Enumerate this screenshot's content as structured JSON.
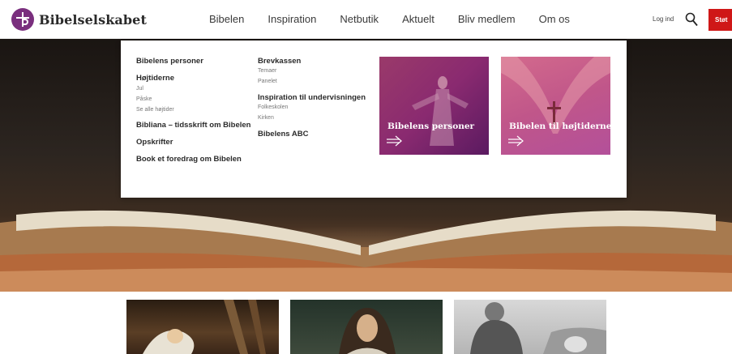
{
  "header": {
    "logo_text": "Bibelselskabet",
    "nav": [
      "Bibelen",
      "Inspiration",
      "Netbutik",
      "Aktuelt",
      "Bliv medlem",
      "Om os"
    ],
    "login": "Log ind",
    "support": "Støt"
  },
  "dropdown": {
    "col1": {
      "bibelens_personer": "Bibelens personer",
      "hojtiderne": "Højtiderne",
      "hojtider_items": [
        "Jul",
        "Påske",
        "Se alle højtider"
      ],
      "bibliana": "Bibliana – tidsskrift om Bibelen",
      "opskrifter": "Opskrifter",
      "book": "Book et foredrag om Bibelen"
    },
    "col2": {
      "brevkassen": "Brevkassen",
      "brevkassen_items": [
        "Temaer",
        "Panelet"
      ],
      "undervisning": "Inspiration til undervisningen",
      "undervisning_items": [
        "Folkeskolen",
        "Kirken"
      ],
      "abc": "Bibelens ABC"
    },
    "cards": [
      {
        "title": "Bibelens personer",
        "color": "#8a2a70"
      },
      {
        "title": "Bibelen til højtiderne",
        "color": "#c0568a"
      }
    ]
  },
  "colors": {
    "brand": "#7a2f7e",
    "support_button": "#cf1717"
  }
}
